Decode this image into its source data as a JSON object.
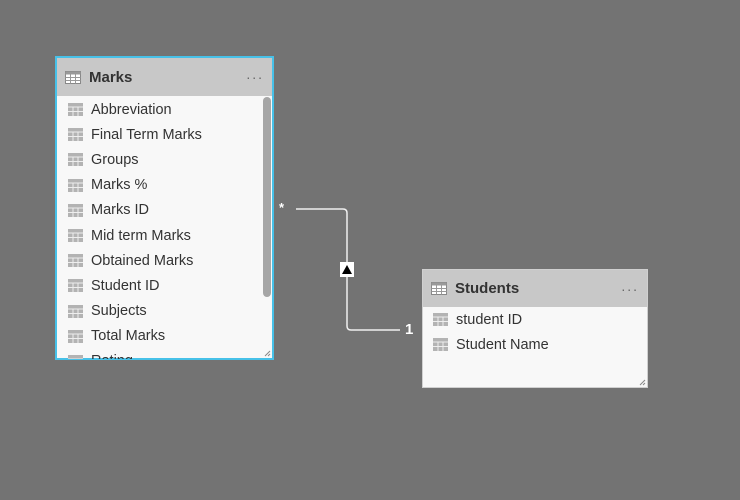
{
  "canvas": {
    "background": "#737373",
    "accent": "#47c1e8"
  },
  "tables": [
    {
      "name": "Marks",
      "selected": true,
      "menu_label": "...",
      "fields": [
        "Abbreviation",
        "Final Term Marks",
        "Groups",
        "Marks %",
        "Marks ID",
        "Mid term Marks",
        "Obtained Marks",
        "Student ID",
        "Subjects",
        "Total Marks",
        "Rating"
      ]
    },
    {
      "name": "Students",
      "selected": false,
      "menu_label": "...",
      "fields": [
        "student ID",
        "Student Name"
      ]
    }
  ],
  "relationship": {
    "from_table": "Marks",
    "to_table": "Students",
    "from_cardinality": "*",
    "to_cardinality": "1",
    "cross_filter_direction": "single",
    "direction_glyph": "▲"
  }
}
